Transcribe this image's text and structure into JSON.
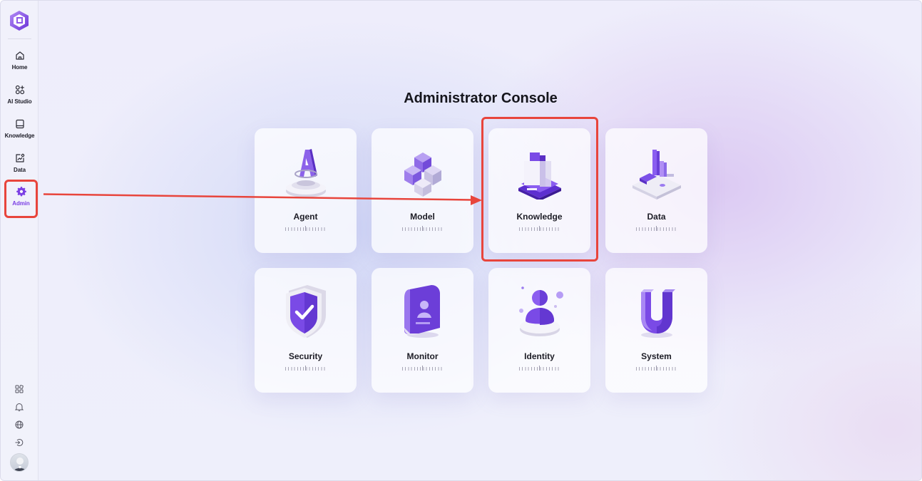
{
  "sidebar": {
    "items": [
      {
        "label": "Home",
        "icon": "home-icon"
      },
      {
        "label": "AI Studio",
        "icon": "ai-studio-icon"
      },
      {
        "label": "Knowledge",
        "icon": "book-icon"
      },
      {
        "label": "Data",
        "icon": "data-chart-icon"
      },
      {
        "label": "Admin",
        "icon": "gear-icon",
        "active": true
      }
    ],
    "utilities": [
      "layout-icon",
      "bell-icon",
      "globe-icon",
      "logout-icon"
    ],
    "active_color": "#7b3fe4"
  },
  "main": {
    "title": "Administrator Console",
    "cards": [
      {
        "label": "Agent",
        "icon": "agent-3d-icon"
      },
      {
        "label": "Model",
        "icon": "model-cubes-icon"
      },
      {
        "label": "Knowledge",
        "icon": "knowledge-books-icon"
      },
      {
        "label": "Data",
        "icon": "data-bars-icon"
      },
      {
        "label": "Security",
        "icon": "shield-check-icon"
      },
      {
        "label": "Monitor",
        "icon": "monitor-badge-icon"
      },
      {
        "label": "Identity",
        "icon": "identity-user-icon"
      },
      {
        "label": "System",
        "icon": "magnet-icon"
      }
    ]
  },
  "annotation": {
    "color": "#e8453c"
  }
}
